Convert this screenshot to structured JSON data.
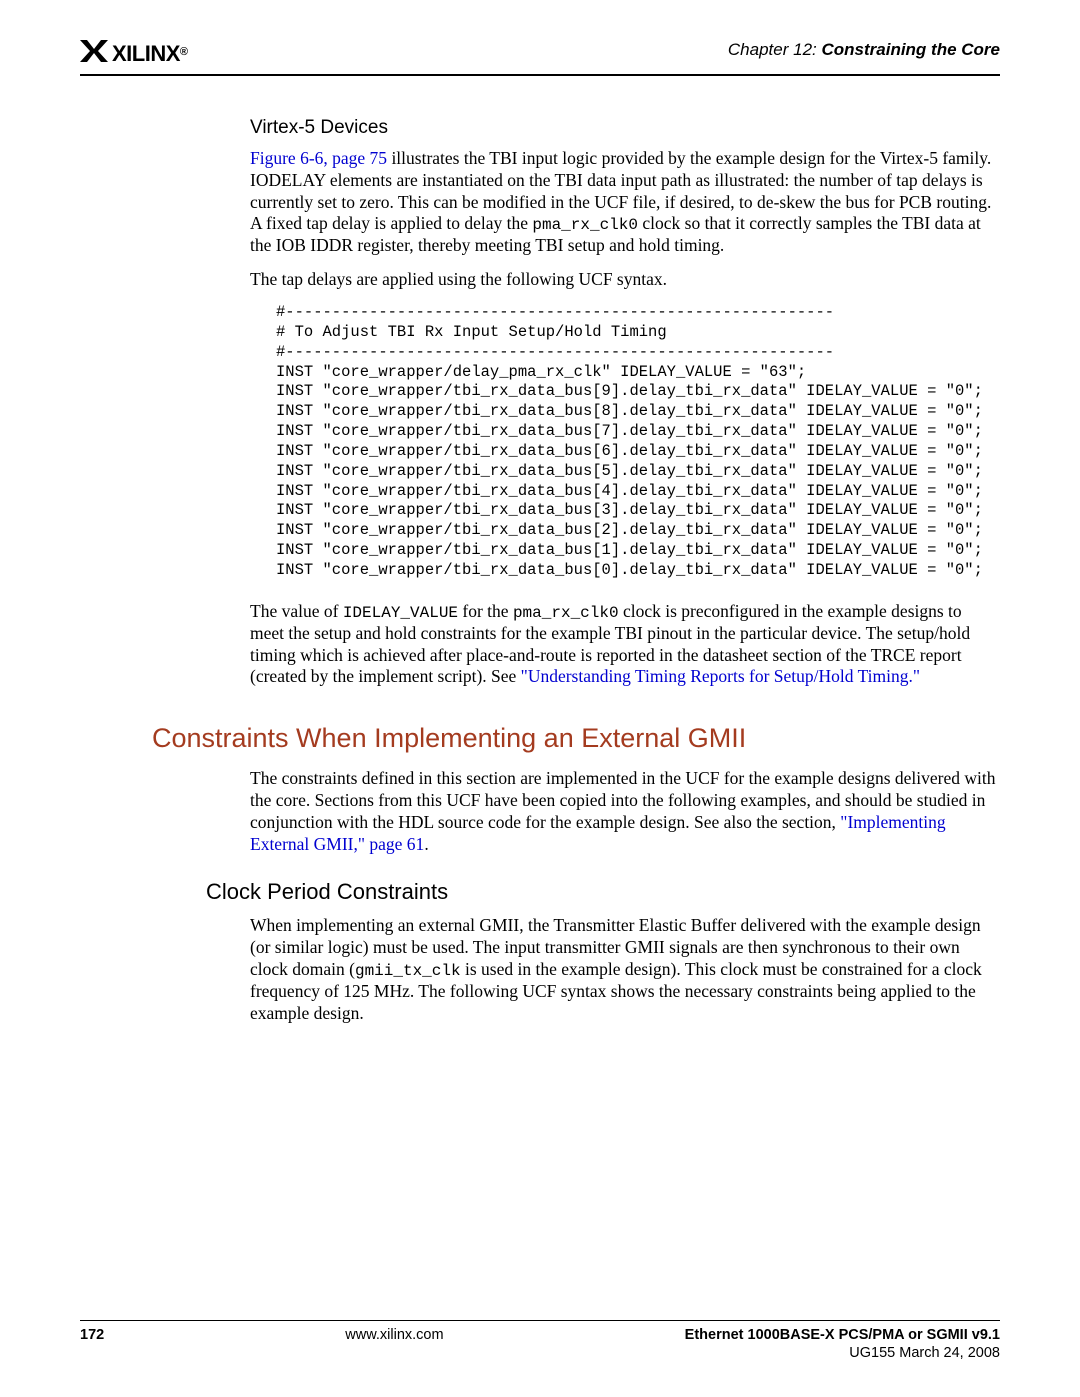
{
  "header": {
    "logo_text": "XILINX",
    "chapter_prefix": "Chapter 12:",
    "chapter_title": "Constraining the Core"
  },
  "section1": {
    "sub_heading": "Virtex-5 Devices",
    "p1a_link": "Figure 6-6, page 75",
    "p1a": " illustrates the TBI input logic provided by the example design for the Virtex-5 family. IODELAY elements are instantiated on the TBI data input path as illustrated: the number of tap delays is currently set to zero. This can be modified in the UCF file, if desired, to de-skew the bus for PCB routing. A fixed tap delay is applied to delay the ",
    "p1a_code": "pma_rx_clk0",
    "p1a_tail": " clock so that it correctly samples the TBI data at the IOB IDDR register, thereby meeting TBI setup and hold timing.",
    "p1b": "The tap delays are applied using the following UCF syntax.",
    "code_block": "#-----------------------------------------------------------\n# To Adjust TBI Rx Input Setup/Hold Timing\n#-----------------------------------------------------------\nINST \"core_wrapper/delay_pma_rx_clk\" IDELAY_VALUE = \"63\";\nINST \"core_wrapper/tbi_rx_data_bus[9].delay_tbi_rx_data\" IDELAY_VALUE = \"0\";\nINST \"core_wrapper/tbi_rx_data_bus[8].delay_tbi_rx_data\" IDELAY_VALUE = \"0\";\nINST \"core_wrapper/tbi_rx_data_bus[7].delay_tbi_rx_data\" IDELAY_VALUE = \"0\";\nINST \"core_wrapper/tbi_rx_data_bus[6].delay_tbi_rx_data\" IDELAY_VALUE = \"0\";\nINST \"core_wrapper/tbi_rx_data_bus[5].delay_tbi_rx_data\" IDELAY_VALUE = \"0\";\nINST \"core_wrapper/tbi_rx_data_bus[4].delay_tbi_rx_data\" IDELAY_VALUE = \"0\";\nINST \"core_wrapper/tbi_rx_data_bus[3].delay_tbi_rx_data\" IDELAY_VALUE = \"0\";\nINST \"core_wrapper/tbi_rx_data_bus[2].delay_tbi_rx_data\" IDELAY_VALUE = \"0\";\nINST \"core_wrapper/tbi_rx_data_bus[1].delay_tbi_rx_data\" IDELAY_VALUE = \"0\";\nINST \"core_wrapper/tbi_rx_data_bus[0].delay_tbi_rx_data\" IDELAY_VALUE = \"0\";",
    "p2_lead": "The value of ",
    "p2_code1": "IDELAY_VALUE",
    "p2_mid1": " for the ",
    "p2_code2": "pma_rx_clk0",
    "p2_tail": " clock is preconfigured in the example designs to meet the setup and hold constraints for the example TBI pinout in the particular device. The setup/hold timing which is achieved after place-and-route is reported in the datasheet section of the TRCE report (created by the implement script). See ",
    "p2_link": "\"Understanding Timing Reports for Setup/Hold Timing.\""
  },
  "section2": {
    "heading": "Constraints When Implementing an External GMII",
    "p1": "The constraints defined in this section are implemented in the UCF for the example designs delivered with the core. Sections from this UCF have been copied into the following examples, and should be studied in conjunction with the HDL source code for the example design. See also the section, ",
    "p1_link": "\"Implementing External GMII,\" page 61",
    "p1_tail": ".",
    "sub_heading": "Clock Period Constraints",
    "p2_a": "When implementing an external GMII, the Transmitter Elastic Buffer delivered with the example design (or similar logic) must be used. The input transmitter GMII signals are then synchronous to their own clock domain (",
    "p2_code": "gmii_tx_clk",
    "p2_b": " is used in the example design). This clock must be constrained for a clock frequency of 125 MHz. The following UCF syntax shows the necessary constraints being applied to the example design."
  },
  "footer": {
    "page": "172",
    "url": "www.xilinx.com",
    "doc": "Ethernet 1000BASE-X PCS/PMA or SGMII v9.1",
    "date": "UG155 March 24, 2008"
  }
}
